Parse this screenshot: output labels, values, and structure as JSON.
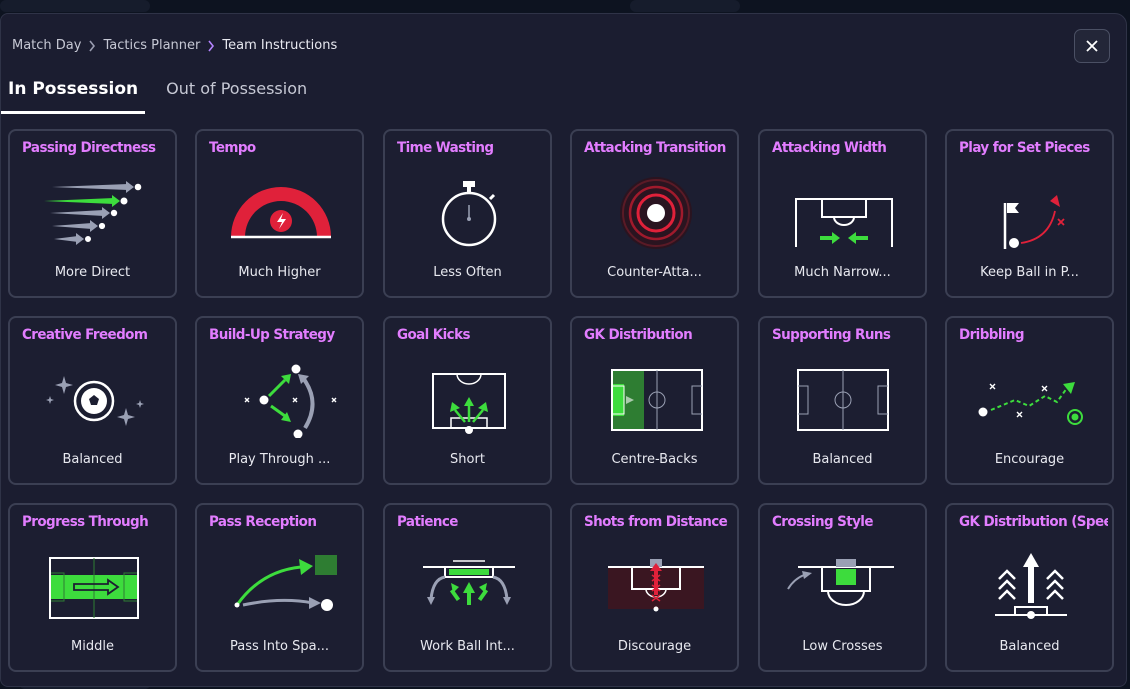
{
  "breadcrumb": {
    "items": [
      "Match Day",
      "Tactics Planner",
      "Team Instructions"
    ]
  },
  "tabs": {
    "in_possession": "In Possession",
    "out_of_possession": "Out of Possession"
  },
  "colors": {
    "accent_title": "#e27dff",
    "accent_green": "#3ddc3d",
    "accent_red": "#e0213a",
    "card_border": "#3b3f53"
  },
  "cards": [
    {
      "title": "Passing Directness",
      "value": "More Direct",
      "icon": "passing-directness-icon"
    },
    {
      "title": "Tempo",
      "value": "Much Higher",
      "icon": "tempo-gauge-icon"
    },
    {
      "title": "Time Wasting",
      "value": "Less Often",
      "icon": "stopwatch-icon"
    },
    {
      "title": "Attacking Transition",
      "value": "Counter-Atta...",
      "icon": "counter-attack-target-icon"
    },
    {
      "title": "Attacking Width",
      "value": "Much Narrow...",
      "icon": "attacking-width-icon"
    },
    {
      "title": "Play for Set Pieces",
      "value": "Keep Ball in P...",
      "icon": "set-pieces-flag-icon"
    },
    {
      "title": "Creative Freedom",
      "value": "Balanced",
      "icon": "creative-freedom-ball-icon"
    },
    {
      "title": "Build-Up Strategy",
      "value": "Play Through ...",
      "icon": "build-up-strategy-icon"
    },
    {
      "title": "Goal Kicks",
      "value": "Short",
      "icon": "goal-kicks-icon"
    },
    {
      "title": "GK Distribution",
      "value": "Centre-Backs",
      "icon": "gk-distribution-pitch-icon"
    },
    {
      "title": "Supporting Runs",
      "value": "Balanced",
      "icon": "supporting-runs-pitch-icon"
    },
    {
      "title": "Dribbling",
      "value": "Encourage",
      "icon": "dribbling-icon"
    },
    {
      "title": "Progress Through",
      "value": "Middle",
      "icon": "progress-through-middle-icon"
    },
    {
      "title": "Pass Reception",
      "value": "Pass Into Spa...",
      "icon": "pass-reception-icon"
    },
    {
      "title": "Patience",
      "value": "Work Ball Int...",
      "icon": "patience-box-icon"
    },
    {
      "title": "Shots from Distance",
      "value": "Discourage",
      "icon": "shots-from-distance-icon"
    },
    {
      "title": "Crossing Style",
      "value": "Low Crosses",
      "icon": "crossing-style-icon"
    },
    {
      "title": "GK Distribution (Speed",
      "value": "Balanced",
      "icon": "gk-distribution-speed-icon"
    }
  ]
}
